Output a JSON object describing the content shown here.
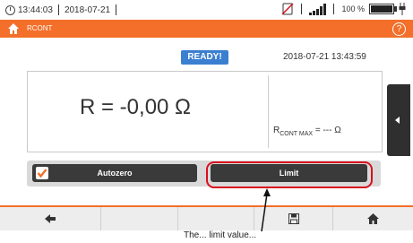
{
  "statusbar": {
    "time": "13:44:03",
    "date": "2018-07-21",
    "battery_text": "100 %",
    "battery_level": 1.0
  },
  "titlebar": {
    "title": "RCONT",
    "help_symbol": "?"
  },
  "main": {
    "status_badge": "READY!",
    "datetime": "2018-07-21 13:43:59",
    "value": "R = -0,00 Ω",
    "limit_prefix": "R",
    "limit_sub": "CONT MAX",
    "limit_value": " = --- Ω"
  },
  "buttons": {
    "autozero_label": "Autozero",
    "autozero_checked": true,
    "limit_label": "Limit"
  },
  "bottom_nav": [
    "back-arrow-icon",
    "",
    "",
    "",
    "save-icon",
    "home-icon"
  ],
  "annotation": {
    "text": "The... limit value..."
  },
  "colors": {
    "accent": "#f36f2a",
    "ready_badge": "#3b7fd1",
    "highlight": "#d9101e",
    "button": "#3a3a3a"
  }
}
